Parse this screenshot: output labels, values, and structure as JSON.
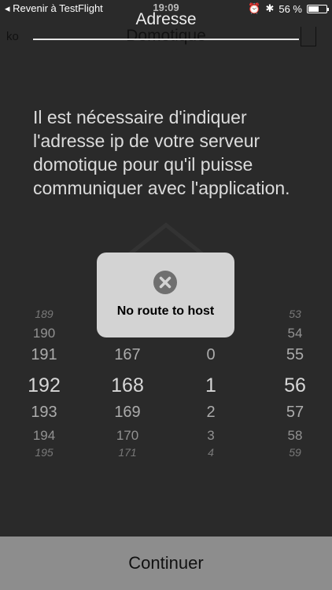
{
  "status_bar": {
    "back_label": "◂ Revenir à TestFlight",
    "time": "19:09",
    "battery_label": "56 %",
    "battery_level": 0.56
  },
  "nav": {
    "background_title": "Domotique",
    "background_left": "ko",
    "overlay_title": "Adresse"
  },
  "intro_text": "Il est nécessaire d'indiquer l'adresse ip de votre serveur domotique pour qu'il puisse communiquer avec l'application.",
  "picker": {
    "columns": [
      {
        "values": [
          "189",
          "190",
          "191",
          "192",
          "193",
          "194",
          "195"
        ]
      },
      {
        "values": [
          "167",
          "168",
          "169",
          "170",
          "171"
        ]
      },
      {
        "values": [
          "0",
          "1",
          "2",
          "3",
          "4"
        ]
      },
      {
        "values": [
          "53",
          "54",
          "55",
          "56",
          "57",
          "58",
          "59"
        ]
      }
    ],
    "selected": [
      "192",
      "168",
      "1",
      "56"
    ]
  },
  "alert": {
    "message": "No route to host",
    "icon": "error-x-icon"
  },
  "continue_label": "Continuer"
}
